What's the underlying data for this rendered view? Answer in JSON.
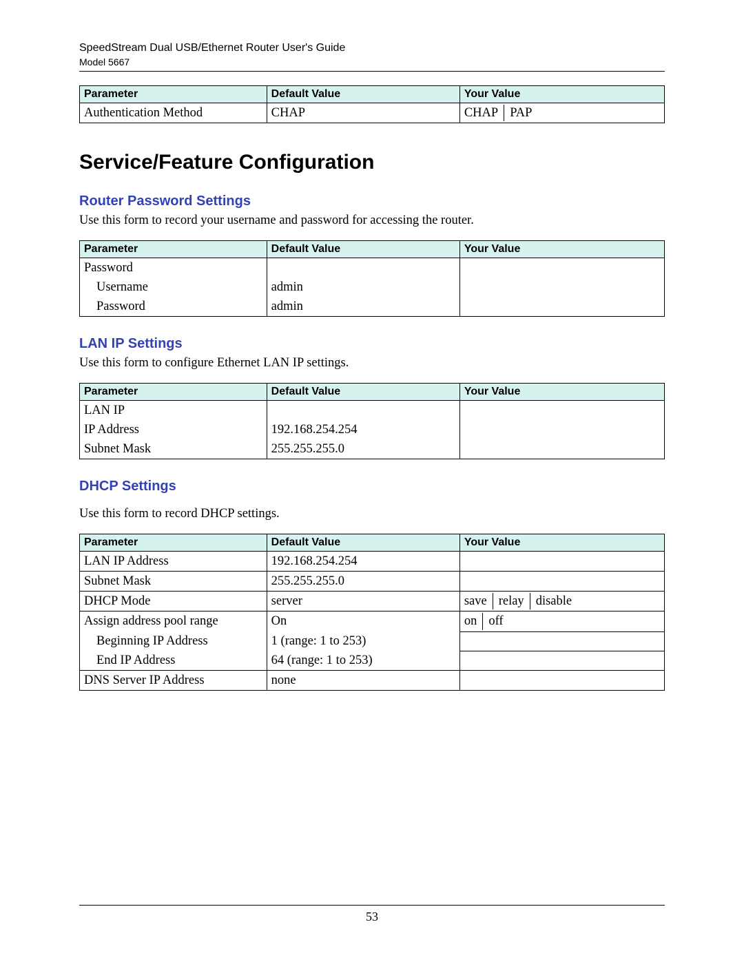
{
  "header": {
    "title": "SpeedStream Dual USB/Ethernet Router User's Guide",
    "model": "Model 5667"
  },
  "columns": {
    "parameter": "Parameter",
    "default": "Default Value",
    "your": "Your Value"
  },
  "auth_table": {
    "row": {
      "param": "Authentication Method",
      "default": "CHAP",
      "your1": "CHAP",
      "your2": "PAP"
    }
  },
  "section_title": "Service/Feature Configuration",
  "router_pw": {
    "heading": "Router Password Settings",
    "desc": "Use this form to record your username and password for accessing the router.",
    "rows": {
      "r0": {
        "param": "Password",
        "default": "",
        "your": ""
      },
      "r1": {
        "param": "Username",
        "default": "admin",
        "your": ""
      },
      "r2": {
        "param": "Password",
        "default": "admin",
        "your": ""
      }
    }
  },
  "lan_ip": {
    "heading": "LAN IP Settings",
    "desc": "Use this form to configure Ethernet LAN IP settings.",
    "rows": {
      "r0": {
        "param": "LAN IP",
        "default": "",
        "your": ""
      },
      "r1": {
        "param": "IP Address",
        "default": "192.168.254.254",
        "your": ""
      },
      "r2": {
        "param": "Subnet Mask",
        "default": "255.255.255.0",
        "your": ""
      }
    }
  },
  "dhcp": {
    "heading": "DHCP Settings",
    "desc": "Use this form to record DHCP settings.",
    "rows": {
      "r0": {
        "param": "LAN IP Address",
        "default": "192.168.254.254",
        "your": ""
      },
      "r1": {
        "param": "Subnet Mask",
        "default": "255.255.255.0",
        "your": ""
      },
      "r2": {
        "param": "DHCP Mode",
        "default": "server",
        "your1": "save",
        "your2": "relay",
        "your3": "disable"
      },
      "r3": {
        "param": "Assign address pool range",
        "default": "On",
        "your1": "on",
        "your2": "off"
      },
      "r4": {
        "param": "Beginning IP Address",
        "default": "1 (range: 1 to 253)",
        "your": ""
      },
      "r5": {
        "param": "End IP Address",
        "default": "64 (range: 1 to 253)",
        "your": ""
      },
      "r6": {
        "param": "DNS Server IP Address",
        "default": "none",
        "your": ""
      }
    }
  },
  "page_number": "53"
}
